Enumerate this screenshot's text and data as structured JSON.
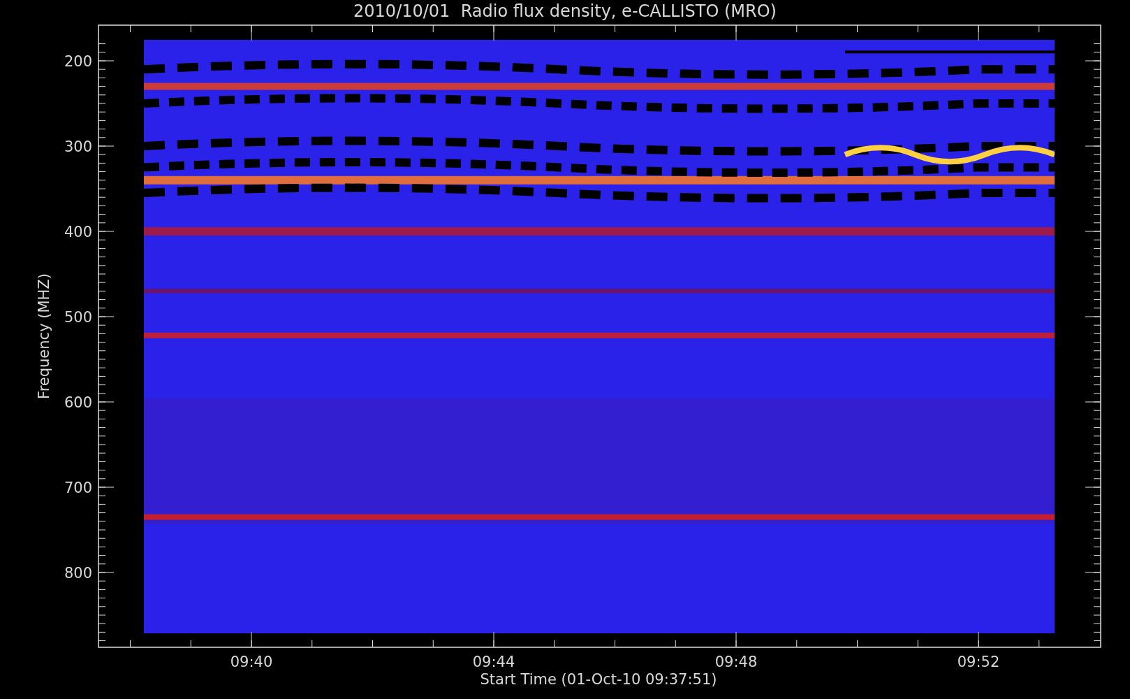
{
  "title": "2010/10/01  Radio flux density, e-CALLISTO (MRO)",
  "y_axis": {
    "label": "Frequency (MHZ)",
    "ticks": [
      "200",
      "300",
      "400",
      "500",
      "600",
      "700",
      "800"
    ]
  },
  "x_axis": {
    "label": "Start Time (01-Oct-10 09:37:51)",
    "ticks": [
      "09:40",
      "09:44",
      "09:48",
      "09:52"
    ]
  }
}
